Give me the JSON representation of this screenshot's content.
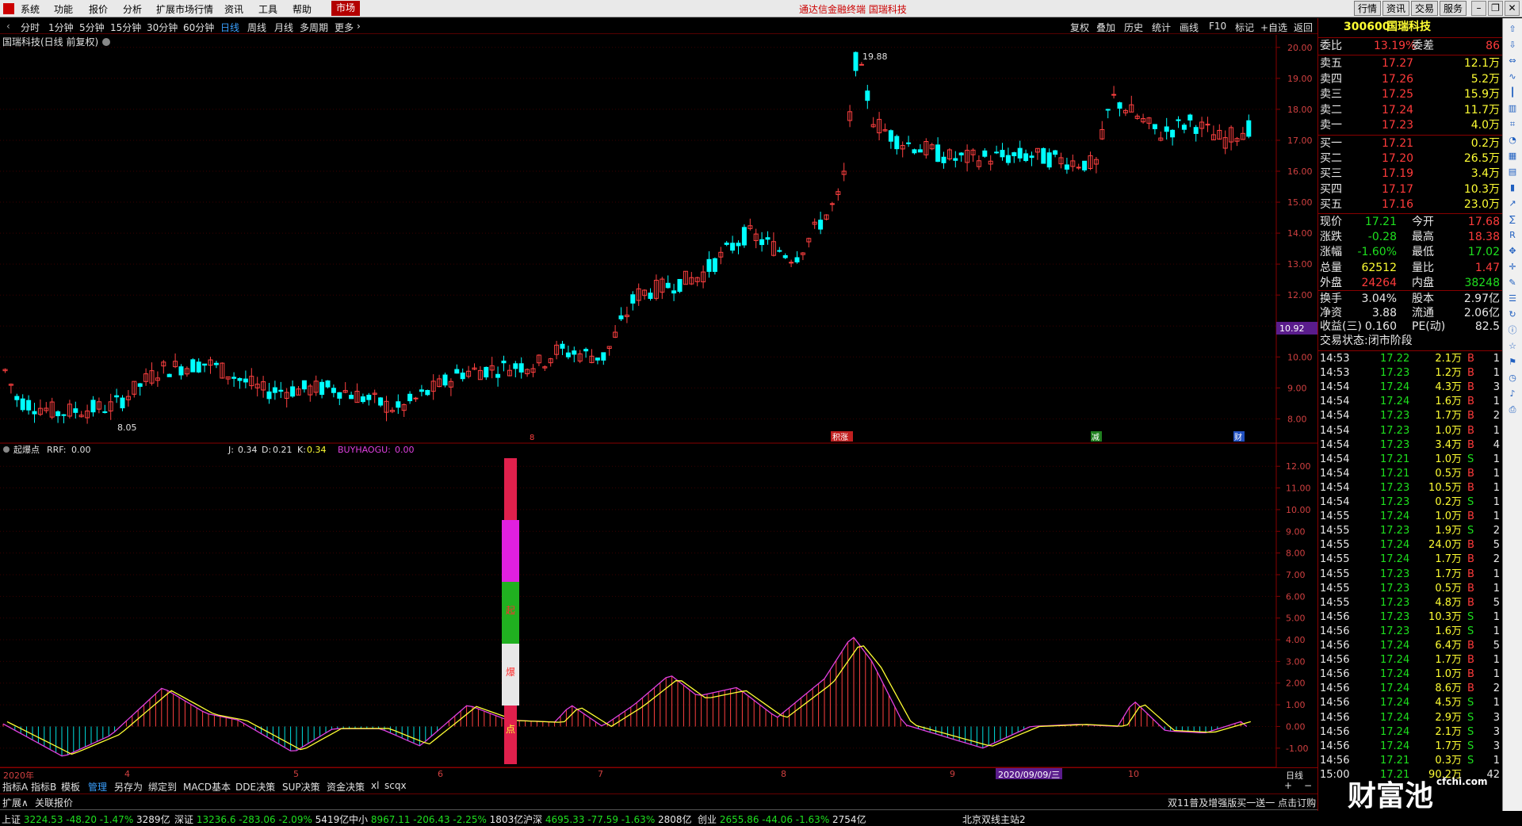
{
  "menu": {
    "items": [
      "系统",
      "功能",
      "报价",
      "分析",
      "扩展市场行情",
      "资讯",
      "工具",
      "帮助"
    ],
    "active": "市场",
    "title": "通达信金融终端  国瑞科技",
    "right_buttons": [
      "行情",
      "资讯",
      "交易",
      "服务"
    ]
  },
  "periods": {
    "items": [
      "分时",
      "1分钟",
      "5分钟",
      "15分钟",
      "30分钟",
      "60分钟",
      "日线",
      "周线",
      "月线",
      "多周期",
      "更多"
    ],
    "selected": "日线"
  },
  "tools": [
    "复权",
    "叠加",
    "历史",
    "统计",
    "画线",
    "F10",
    "标记",
    "+自选",
    "返回"
  ],
  "chart_title": "国瑞科技(日线 前复权)",
  "price_axis": [
    "20.00",
    "19.00",
    "18.00",
    "17.00",
    "16.00",
    "15.00",
    "14.00",
    "13.00",
    "12.00",
    "11.00",
    "10.00",
    "9.00",
    "8.00"
  ],
  "price_cursor": "10.92",
  "annotations": {
    "high": "19.88",
    "low": "8.05"
  },
  "event_markers": [
    "8",
    "积涨",
    "减",
    "财"
  ],
  "indicator": {
    "name": "起爆点",
    "rrf_label": "RRF:",
    "rrf_value": "0.00",
    "j_label": "J:",
    "j_value": "0.34",
    "d_label": "D:",
    "d_value": "0.21",
    "k_label": "K:",
    "k_value": "0.34",
    "buy_label": "BUYHAOGU:",
    "buy_value": "0.00",
    "axis": [
      "12.00",
      "11.00",
      "10.00",
      "9.00",
      "8.00",
      "7.00",
      "6.00",
      "5.00",
      "4.00",
      "3.00",
      "2.00",
      "1.00",
      "0.00",
      "-1.00"
    ],
    "bar_chars": [
      "起",
      "爆",
      "点"
    ]
  },
  "time_axis": {
    "labels": [
      "2020年",
      "4",
      "5",
      "6",
      "7",
      "8",
      "9",
      "10"
    ],
    "cursor_date": "2020/09/09/三",
    "period": "日线"
  },
  "bottom_tabs": {
    "items": [
      "指标A",
      "指标B",
      "模板",
      "管理",
      "另存为",
      "绑定到",
      "MACD基本",
      "DDE决策",
      "SUP决策",
      "资金决策",
      "xl",
      "scqx"
    ],
    "selected": "管理"
  },
  "bottom_tabs2": {
    "items": [
      "扩展∧",
      "关联报价"
    ],
    "ad": "双11普及增强版买一送一 点击订购"
  },
  "quote": {
    "code": "300600",
    "name": "国瑞科技",
    "weibi_label": "委比",
    "weibi": "13.19%",
    "weicha_label": "委差",
    "weicha": "86",
    "sell": [
      {
        "label": "卖五",
        "price": "17.27",
        "vol": "12.1万"
      },
      {
        "label": "卖四",
        "price": "17.26",
        "vol": "5.2万"
      },
      {
        "label": "卖三",
        "price": "17.25",
        "vol": "15.9万"
      },
      {
        "label": "卖二",
        "price": "17.24",
        "vol": "11.7万"
      },
      {
        "label": "卖一",
        "price": "17.23",
        "vol": "4.0万"
      }
    ],
    "buy": [
      {
        "label": "买一",
        "price": "17.21",
        "vol": "0.2万"
      },
      {
        "label": "买二",
        "price": "17.20",
        "vol": "26.5万"
      },
      {
        "label": "买三",
        "price": "17.19",
        "vol": "3.4万"
      },
      {
        "label": "买四",
        "price": "17.17",
        "vol": "10.3万"
      },
      {
        "label": "买五",
        "price": "17.16",
        "vol": "23.0万"
      }
    ],
    "stats": [
      {
        "l1": "现价",
        "v1": "17.21",
        "l2": "今开",
        "v2": "17.68",
        "c1": "green",
        "c2": "red"
      },
      {
        "l1": "涨跌",
        "v1": "-0.28",
        "l2": "最高",
        "v2": "18.38",
        "c1": "green",
        "c2": "red"
      },
      {
        "l1": "涨幅",
        "v1": "-1.60%",
        "l2": "最低",
        "v2": "17.02",
        "c1": "green",
        "c2": "green"
      },
      {
        "l1": "总量",
        "v1": "62512",
        "l2": "量比",
        "v2": "1.47",
        "c1": "yellow",
        "c2": "red"
      },
      {
        "l1": "外盘",
        "v1": "24264",
        "l2": "内盘",
        "v2": "38248",
        "c1": "red",
        "c2": "green"
      }
    ],
    "fin": [
      {
        "l1": "换手",
        "v1": "3.04%",
        "l2": "股本",
        "v2": "2.97亿"
      },
      {
        "l1": "净资",
        "v1": "3.88",
        "l2": "流通",
        "v2": "2.06亿"
      },
      {
        "l1": "收益(三)",
        "v1": "0.160",
        "l2": "PE(动)",
        "v2": "82.5"
      }
    ],
    "trade_state": "交易状态:闭市阶段"
  },
  "ticks": [
    {
      "t": "14:53",
      "p": "17.22",
      "v": "2.1万",
      "s": "B",
      "n": "1"
    },
    {
      "t": "14:53",
      "p": "17.23",
      "v": "1.2万",
      "s": "B",
      "n": "1"
    },
    {
      "t": "14:54",
      "p": "17.24",
      "v": "4.3万",
      "s": "B",
      "n": "3"
    },
    {
      "t": "14:54",
      "p": "17.24",
      "v": "1.6万",
      "s": "B",
      "n": "1"
    },
    {
      "t": "14:54",
      "p": "17.23",
      "v": "1.7万",
      "s": "B",
      "n": "2"
    },
    {
      "t": "14:54",
      "p": "17.23",
      "v": "1.0万",
      "s": "B",
      "n": "1"
    },
    {
      "t": "14:54",
      "p": "17.23",
      "v": "3.4万",
      "s": "B",
      "n": "4"
    },
    {
      "t": "14:54",
      "p": "17.21",
      "v": "1.0万",
      "s": "S",
      "n": "1"
    },
    {
      "t": "14:54",
      "p": "17.21",
      "v": "0.5万",
      "s": "B",
      "n": "1"
    },
    {
      "t": "14:54",
      "p": "17.23",
      "v": "10.5万",
      "s": "B",
      "n": "1"
    },
    {
      "t": "14:54",
      "p": "17.23",
      "v": "0.2万",
      "s": "S",
      "n": "1"
    },
    {
      "t": "14:55",
      "p": "17.24",
      "v": "1.0万",
      "s": "B",
      "n": "1"
    },
    {
      "t": "14:55",
      "p": "17.23",
      "v": "1.9万",
      "s": "S",
      "n": "2"
    },
    {
      "t": "14:55",
      "p": "17.24",
      "v": "24.0万",
      "s": "B",
      "n": "5"
    },
    {
      "t": "14:55",
      "p": "17.24",
      "v": "1.7万",
      "s": "B",
      "n": "2"
    },
    {
      "t": "14:55",
      "p": "17.23",
      "v": "1.7万",
      "s": "B",
      "n": "1"
    },
    {
      "t": "14:55",
      "p": "17.23",
      "v": "0.5万",
      "s": "B",
      "n": "1"
    },
    {
      "t": "14:55",
      "p": "17.23",
      "v": "4.8万",
      "s": "B",
      "n": "5"
    },
    {
      "t": "14:56",
      "p": "17.23",
      "v": "10.3万",
      "s": "S",
      "n": "1"
    },
    {
      "t": "14:56",
      "p": "17.23",
      "v": "1.6万",
      "s": "S",
      "n": "1"
    },
    {
      "t": "14:56",
      "p": "17.24",
      "v": "6.4万",
      "s": "B",
      "n": "5"
    },
    {
      "t": "14:56",
      "p": "17.24",
      "v": "1.7万",
      "s": "B",
      "n": "1"
    },
    {
      "t": "14:56",
      "p": "17.24",
      "v": "1.0万",
      "s": "B",
      "n": "1"
    },
    {
      "t": "14:56",
      "p": "17.24",
      "v": "8.6万",
      "s": "B",
      "n": "2"
    },
    {
      "t": "14:56",
      "p": "17.24",
      "v": "4.5万",
      "s": "S",
      "n": "1"
    },
    {
      "t": "14:56",
      "p": "17.24",
      "v": "2.9万",
      "s": "S",
      "n": "3"
    },
    {
      "t": "14:56",
      "p": "17.24",
      "v": "2.1万",
      "s": "S",
      "n": "3"
    },
    {
      "t": "14:56",
      "p": "17.24",
      "v": "1.7万",
      "s": "S",
      "n": "3"
    },
    {
      "t": "14:56",
      "p": "17.21",
      "v": "0.3万",
      "s": "S",
      "n": "1"
    },
    {
      "t": "15:00",
      "p": "17.21",
      "v": "90.2万",
      "s": "",
      "n": "42"
    }
  ],
  "status_bar": [
    {
      "name": "上证",
      "v": "3224.53",
      "c": "-48.20",
      "p": "-1.47%",
      "a": "3289亿"
    },
    {
      "name": "深证",
      "v": "13236.6",
      "c": "-283.06",
      "p": "-2.09%",
      "a": "5419亿"
    },
    {
      "name": "中小",
      "v": "8967.11",
      "c": "-206.43",
      "p": "-2.25%",
      "a": "1803亿"
    },
    {
      "name": "沪深",
      "v": "4695.33",
      "c": "-77.59",
      "p": "-1.63%",
      "a": "2808亿"
    },
    {
      "name": "创业",
      "v": "2655.86",
      "c": "-44.06",
      "p": "-1.63%",
      "a": "2754亿"
    }
  ],
  "server": "北京双线主站2",
  "watermark": "财富池",
  "watermark_url": "cfchi.com",
  "colors": {
    "up": "#ff3b3b",
    "down": "#1ee01e",
    "candle_down": "#00ffff",
    "accent": "#3aa0ff"
  }
}
